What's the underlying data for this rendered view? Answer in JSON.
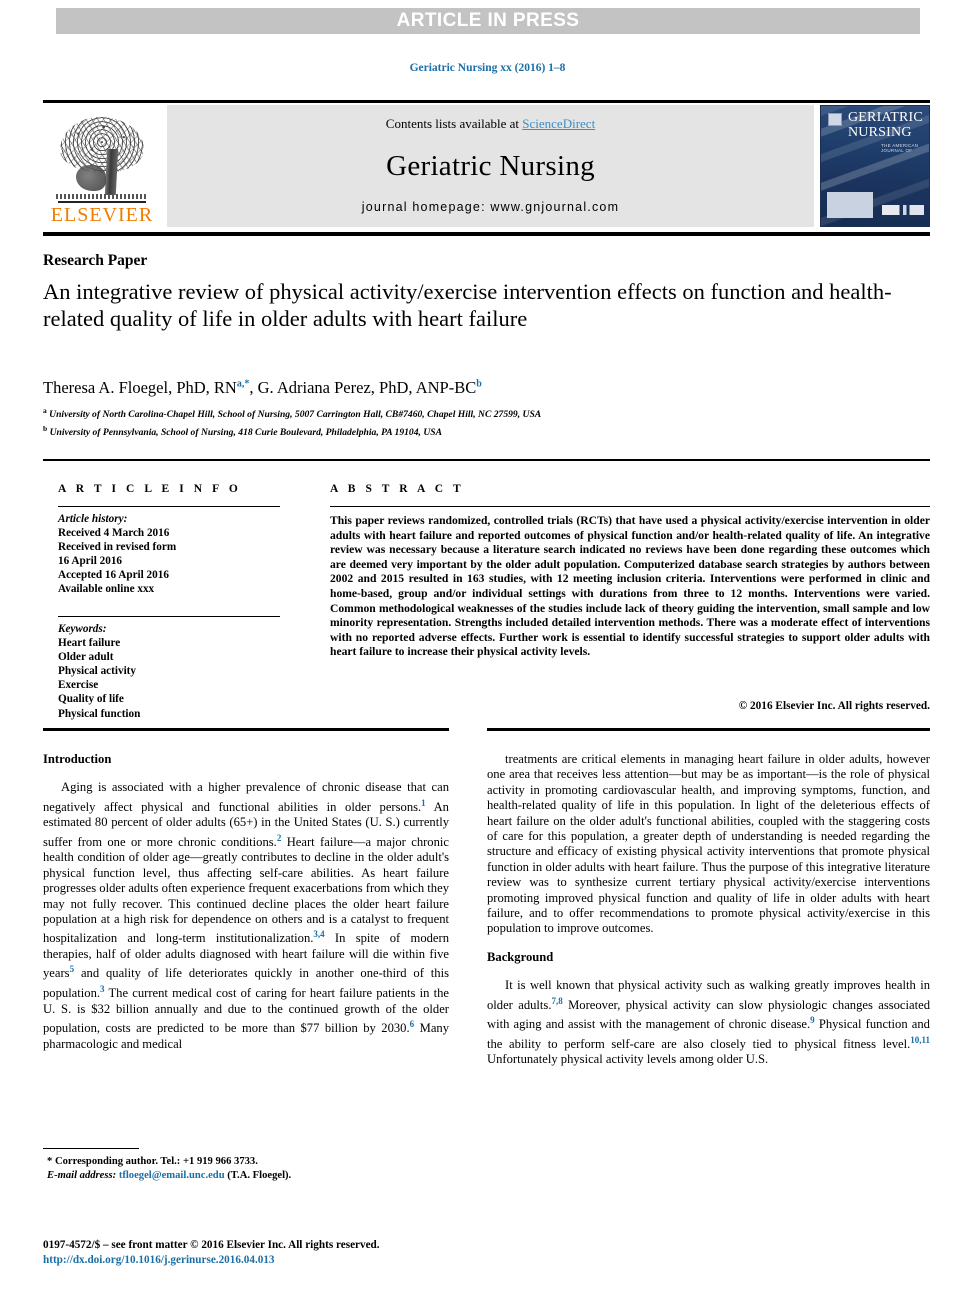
{
  "banner": {
    "label": "ARTICLE IN PRESS"
  },
  "journal_ref": "Geriatric Nursing xx (2016) 1–8",
  "masthead": {
    "contents_prefix": "Contents lists available at ",
    "sciencedirect": "ScienceDirect",
    "journal_title": "Geriatric Nursing",
    "homepage": "journal homepage: www.gnjournal.com",
    "publisher": "ELSEVIER",
    "cover_title_line1": "GERIATRIC",
    "cover_title_line2": "NURSING",
    "cover_subtitle": "THE AMERICAN JOURNAL OF"
  },
  "article": {
    "type": "Research Paper",
    "title": "An integrative review of physical activity/exercise intervention effects on function and health-related quality of life in older adults with heart failure",
    "authors_html": "Theresa A. Floegel, PhD, RN<sup>a,*</sup>, G. Adriana Perez, PhD, ANP-BC<sup>b</sup>",
    "affiliation_a": "University of North Carolina-Chapel Hill, School of Nursing, 5007 Carrington Hall, CB#7460, Chapel Hill, NC 27599, USA",
    "affiliation_b": "University of Pennsylvania, School of Nursing, 418 Curie Boulevard, Philadelphia, PA 19104, USA"
  },
  "info": {
    "heading": "A R T I C L E   I N F O",
    "history_label": "Article history:",
    "history": [
      "Received 4 March 2016",
      "Received in revised form",
      "16 April 2016",
      "Accepted 16 April 2016",
      "Available online xxx"
    ],
    "keywords_label": "Keywords:",
    "keywords": [
      "Heart failure",
      "Older adult",
      "Physical activity",
      "Exercise",
      "Quality of life",
      "Physical function"
    ]
  },
  "abstract": {
    "heading": "A B S T R A C T",
    "text": "This paper reviews randomized, controlled trials (RCTs) that have used a physical activity/exercise intervention in older adults with heart failure and reported outcomes of physical function and/or health-related quality of life. An integrative review was necessary because a literature search indicated no reviews have been done regarding these outcomes which are deemed very important by the older adult population. Computerized database search strategies by authors between 2002 and 2015 resulted in 163 studies, with 12 meeting inclusion criteria. Interventions were performed in clinic and home-based, group and/or individual settings with durations from three to 12 months. Interventions were varied. Common methodological weaknesses of the studies include lack of theory guiding the intervention, small sample and low minority representation. Strengths included detailed intervention methods. There was a moderate effect of interventions with no reported adverse effects. Further work is essential to identify successful strategies to support older adults with heart failure to increase their physical activity levels.",
    "copyright": "© 2016 Elsevier Inc. All rights reserved."
  },
  "body": {
    "left": {
      "heading": "Introduction",
      "paragraph_html": "Aging is associated with a higher prevalence of chronic disease that can negatively affect physical and functional abilities in older persons.<sup class=\"ref\">1</sup> An estimated 80 percent of older adults (65+) in the United States (U. S.) currently suffer from one or more chronic conditions.<sup class=\"ref\">2</sup> Heart failure—a major chronic health condition of older age—greatly contributes to decline in the older adult's physical function level, thus affecting self-care abilities. As heart failure progresses older adults often experience frequent exacerbations from which they may not fully recover. This continued decline places the older heart failure population at a high risk for dependence on others and is a catalyst to frequent hospitalization and long-term institutionalization.<sup class=\"ref\">3,4</sup> In spite of modern therapies, half of older adults diagnosed with heart failure will die within five years<sup class=\"ref\">5</sup> and quality of life deteriorates quickly in another one-third of this population.<sup class=\"ref\">3</sup> The current medical cost of caring for heart failure patients in the U. S. is $32 billion annually and due to the continued growth of the older population, costs are predicted to be more than $77 billion by 2030.<sup class=\"ref\">6</sup> Many pharmacologic and medical"
    },
    "right": {
      "paragraph1_html": "treatments are critical elements in managing heart failure in older adults, however one area that receives less attention—but may be as important—is the role of physical activity in promoting cardiovascular health, and improving symptoms, function, and health-related quality of life in this population. In light of the deleterious effects of heart failure on the older adult's functional abilities, coupled with the staggering costs of care for this population, a greater depth of understanding is needed regarding the structure and efficacy of existing physical activity interventions that promote physical function in older adults with heart failure. Thus the purpose of this integrative literature review was to synthesize current tertiary physical activity/exercise interventions promoting improved physical function and quality of life in older adults with heart failure, and to offer recommendations to promote physical activity/exercise in this population to improve outcomes.",
      "heading2": "Background",
      "paragraph2_html": "It is well known that physical activity such as walking greatly improves health in older adults.<sup class=\"ref\">7,8</sup> Moreover, physical activity can slow physiologic changes associated with aging and assist with the management of chronic disease.<sup class=\"ref\">9</sup> Physical function and the ability to perform self-care are also closely tied to physical fitness level.<sup class=\"ref\">10,11</sup> Unfortunately physical activity levels among older U.S."
    }
  },
  "footnote": {
    "corresponding_html": "* Corresponding author. Tel.: +1 919 966 3733.",
    "email_label": "E-mail address:",
    "email": "tfloegel@email.unc.edu",
    "email_suffix": "(T.A. Floegel)."
  },
  "footer": {
    "issn_line": "0197-4572/$ – see front matter © 2016 Elsevier Inc. All rights reserved.",
    "doi": "http://dx.doi.org/10.1016/j.gerinurse.2016.04.013"
  },
  "colors": {
    "link_blue": "#1a6fa8",
    "banner_gray": "#c3c3c3",
    "masthead_gray": "#e4e4e4",
    "elsevier_orange": "#f07d00"
  }
}
